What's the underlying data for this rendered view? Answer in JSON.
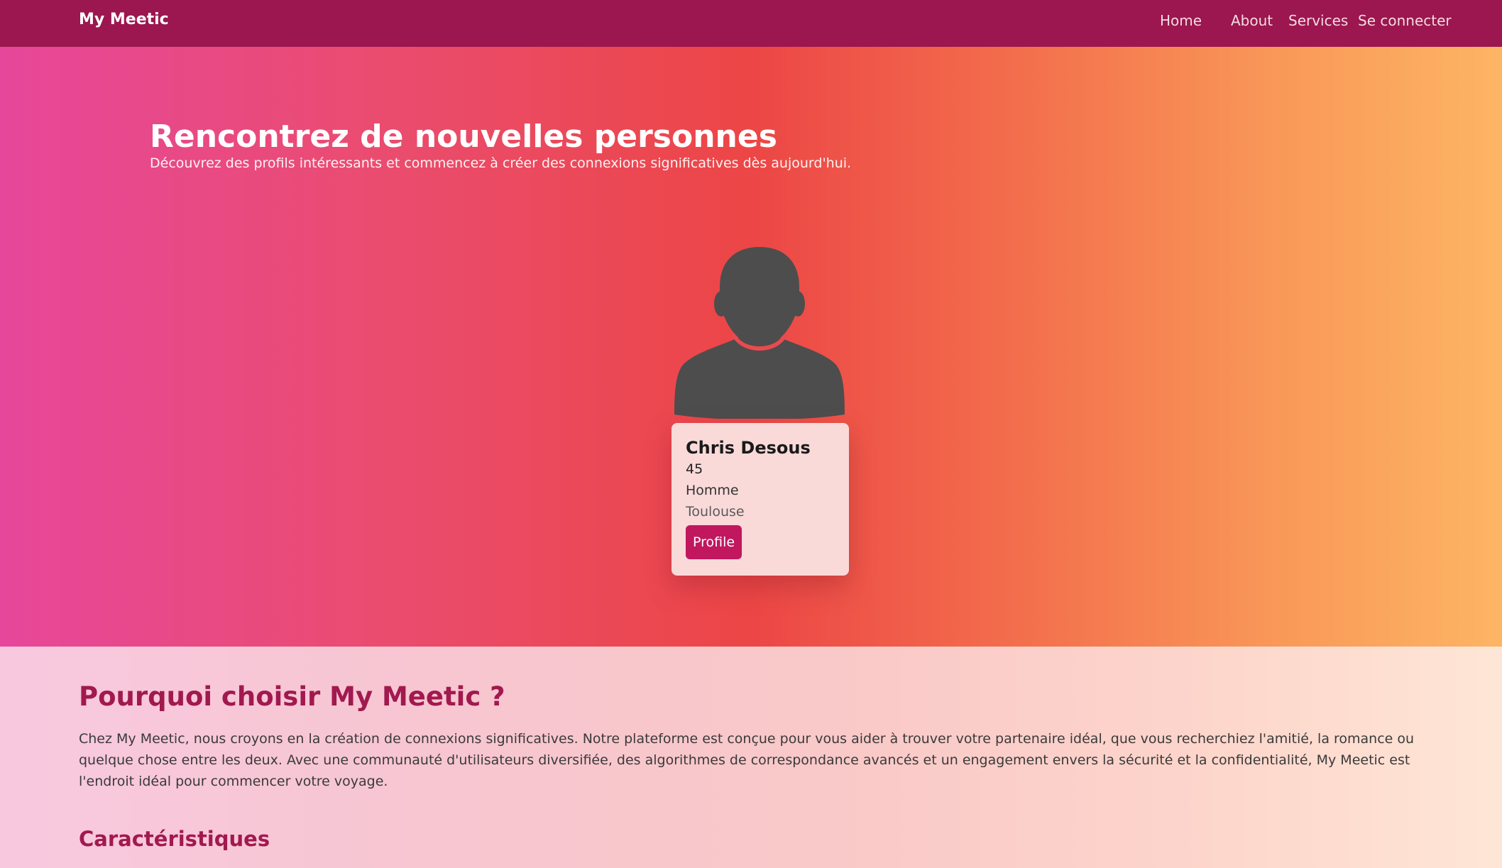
{
  "navbar": {
    "brand": "My Meetic",
    "links": {
      "home": "Home",
      "about": "About",
      "services": "Services",
      "login": "Se connecter"
    }
  },
  "hero": {
    "title": "Rencontrez de nouvelles personnes",
    "subtitle": "Découvrez des profils intéressants et commencez à créer des connexions significatives dès aujourd'hui."
  },
  "profile_card": {
    "avatar_icon": "user-silhouette-icon",
    "name": "Chris Desous",
    "age": "45",
    "gender": "Homme",
    "city": "Toulouse",
    "button_label": "Profile"
  },
  "why_section": {
    "title": "Pourquoi choisir My Meetic ?",
    "text": "Chez My Meetic, nous croyons en la création de connexions significatives. Notre plateforme est conçue pour vous aider à trouver votre partenaire idéal, que vous recherchiez l'amitié, la romance ou quelque chose entre les deux. Avec une communauté d'utilisateurs diversifiée, des algorithmes de correspondance avancés et un engagement envers la sécurité et la confidentialité, My Meetic est l'endroit idéal pour commencer votre voyage.",
    "features_title": "Caractéristiques"
  },
  "colors": {
    "navbar": "#9c164f",
    "accent": "#a1194f",
    "button": "#c1175f",
    "avatar": "#4d4d4d"
  }
}
